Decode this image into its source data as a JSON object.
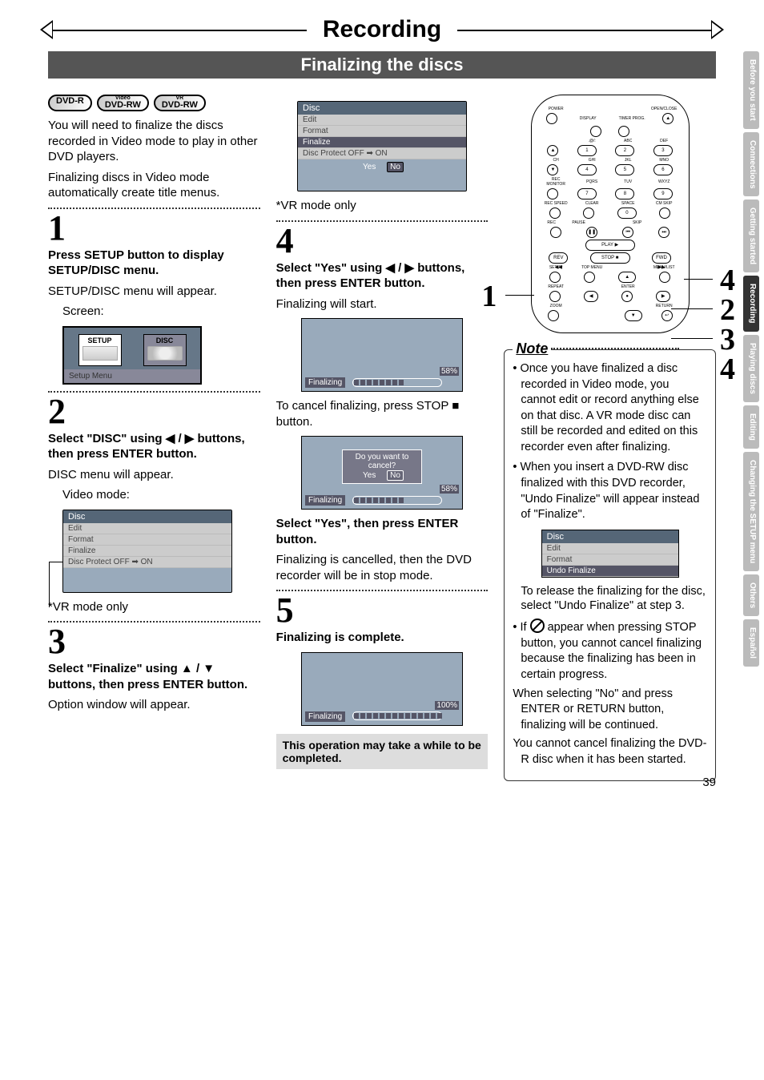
{
  "page_title": "Recording",
  "subtitle": "Finalizing the discs",
  "chips": [
    "DVD-R",
    "DVD-RW",
    "DVD-RW"
  ],
  "chip_sup": [
    "",
    "Video",
    "VR"
  ],
  "intro1": "You will need to finalize the discs recorded in Video mode to play in other DVD players.",
  "intro2": "Finalizing discs in Video mode automatically create title menus.",
  "step1_num": "1",
  "step1_bold": "Press SETUP button to display SETUP/DISC menu.",
  "step1_after": "SETUP/DISC menu will appear.",
  "step1_screen_label": "Screen:",
  "setup_tiles": [
    "SETUP",
    "DISC"
  ],
  "setup_footer": "Setup Menu",
  "step2_num": "2",
  "step2_bold": "Select \"DISC\" using ◀ / ▶ buttons, then press ENTER button.",
  "step2_after": "DISC menu will appear.",
  "step2_mode": "Video mode:",
  "disc_header": "Disc",
  "disc_items": [
    "Edit",
    "Format",
    "Finalize",
    "Disc Protect OFF ➡ ON"
  ],
  "vr_only": "*VR mode only",
  "step3_num": "3",
  "step3_bold": "Select \"Finalize\" using ▲ / ▼ buttons, then press ENTER button.",
  "step3_after": "Option window will appear.",
  "step4_num": "4",
  "step4_osd_items": [
    "Edit",
    "Format",
    "Finalize",
    "Disc Protect OFF ➡ ON"
  ],
  "step4_yes": "Yes",
  "step4_no": "No",
  "vr_only_2": "*VR mode only",
  "step4_bold": "Select \"Yes\" using ◀ / ▶ buttons, then press ENTER button.",
  "step4_after": "Finalizing will start.",
  "prog_label": "Finalizing",
  "pct_58": "58%",
  "pct_100": "100%",
  "cancel_text": "To cancel finalizing, press STOP ■ button.",
  "prompt_text": "Do you want to cancel?",
  "select_yes_bold": "Select \"Yes\", then press ENTER button.",
  "select_yes_after": "Finalizing is cancelled, then the DVD recorder will be in stop mode.",
  "step5_num": "5",
  "step5_bold": "Finalizing is complete.",
  "warn_text": "This operation may take a while to be completed.",
  "remote_labels": {
    "power": "POWER",
    "display": "DISPLAY",
    "timer": "TIMER PROG.",
    "open": "OPEN/CLOSE",
    "at": ".@/:",
    "abc": "ABC",
    "def": "DEF",
    "ch": "CH",
    "ghi": "GHI",
    "jkl": "JKL",
    "mno": "MNO",
    "recmon": "REC MONITOR",
    "pqrs": "PQRS",
    "tuv": "TUV",
    "wxyz": "WXYZ",
    "recspeed": "REC SPEED",
    "clear": "CLEAR",
    "space": "SPACE",
    "cmskip": "CM SKIP",
    "rec": "REC",
    "pause": "PAUSE",
    "skip": "SKIP",
    "play": "PLAY",
    "rev": "REV",
    "fwd": "FWD",
    "stop": "STOP",
    "setup": "SETUP",
    "topmenu": "TOP MENU",
    "menulist": "MENU/LIST",
    "repeat": "REPEAT",
    "enter": "ENTER",
    "zoom": "ZOOM",
    "return": "RETURN",
    "nums": [
      "1",
      "2",
      "3",
      "4",
      "5",
      "6",
      "7",
      "8",
      "9",
      "0"
    ]
  },
  "callouts": {
    "left": "1",
    "r1": "4",
    "r2": "2",
    "r3": "3",
    "r4": "4"
  },
  "note_title": "Note",
  "note1": "Once you have finalized a disc recorded in Video mode, you cannot edit or record anything else on that disc. A VR mode disc can still be recorded and edited on this recorder even after finalizing.",
  "note2": "When you insert a DVD-RW disc finalized with this DVD recorder, \"Undo Finalize\" will appear instead of  \"Finalize\".",
  "mini_items": [
    "Edit",
    "Format",
    "Undo Finalize"
  ],
  "release_text": "To release the finalizing for the disc, select \"Undo Finalize\" at step 3.",
  "note3a": "If ",
  "note3b": " appear when pressing STOP button, you cannot cancel finalizing because the finalizing has been in certain progress.",
  "note3c": "When selecting \"No\" and press ENTER or RETURN button, finalizing will be continued.",
  "note3d": "You cannot cancel finalizing the DVD-R disc when it has been started.",
  "tabs": [
    "Before you start",
    "Connections",
    "Getting started",
    "Recording",
    "Playing discs",
    "Editing",
    "Changing the SETUP menu",
    "Others",
    "Español"
  ],
  "page_num": "39"
}
